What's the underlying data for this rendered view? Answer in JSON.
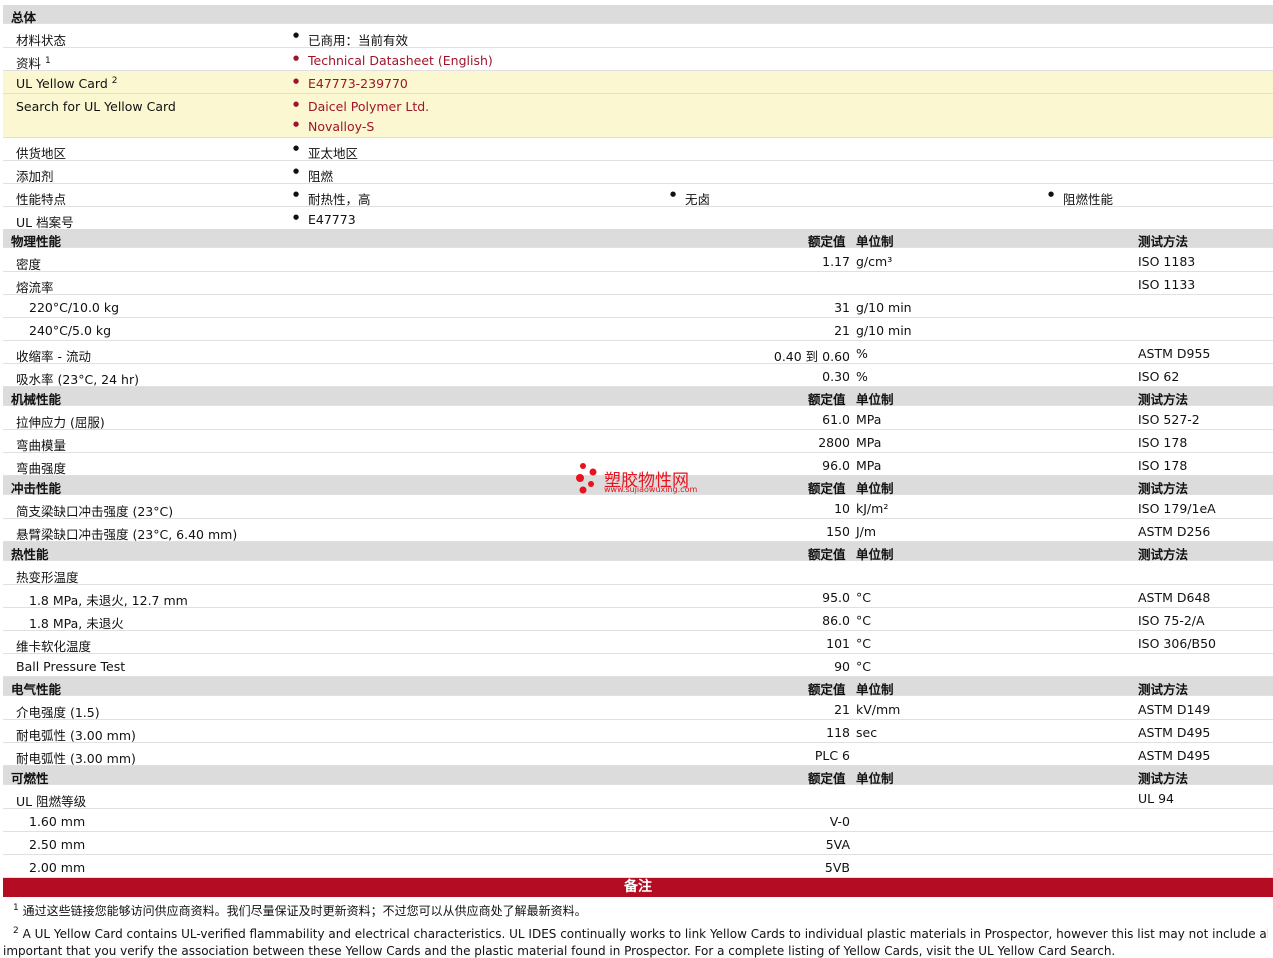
{
  "general": {
    "title": "总体",
    "rows": [
      {
        "label": "材料状态",
        "items": [
          "已商用：当前有效"
        ]
      },
      {
        "label": "资料",
        "sup": "1",
        "items": [
          "Technical Datasheet (English)"
        ]
      },
      {
        "label": "UL Yellow Card",
        "sup": "2",
        "items": [
          "E47773-239770"
        ]
      },
      {
        "label": "Search for UL Yellow Card",
        "items": [
          "Daicel Polymer Ltd.",
          "Novalloy-S"
        ]
      },
      {
        "label": "供货地区",
        "items": [
          "亚太地区"
        ]
      },
      {
        "label": "添加剂",
        "items": [
          "阻燃"
        ]
      },
      {
        "label": "性能特点",
        "items": [
          "耐热性，高",
          "无卤",
          "阻燃性能"
        ]
      },
      {
        "label": "UL 档案号",
        "items": [
          "E47773"
        ]
      }
    ]
  },
  "col_headers": {
    "value": "额定值",
    "unit": "单位制",
    "method": "测试方法"
  },
  "physical": {
    "title": "物理性能",
    "rows": [
      {
        "label": "密度",
        "value": "1.17",
        "unit": "g/cm³",
        "method": "ISO 1183"
      },
      {
        "label": "熔流率",
        "value": "",
        "unit": "",
        "method": "ISO 1133"
      },
      {
        "label": "220°C/10.0 kg",
        "value": "31",
        "unit": "g/10 min",
        "method": ""
      },
      {
        "label": "240°C/5.0 kg",
        "value": "21",
        "unit": "g/10 min",
        "method": ""
      },
      {
        "label": "收缩率  - 流动",
        "value": "0.40 到  0.60",
        "unit": "%",
        "method": "ASTM D955"
      },
      {
        "label": "吸水率  (23°C, 24 hr)",
        "value": "0.30",
        "unit": "%",
        "method": "ISO 62"
      }
    ]
  },
  "mechanical": {
    "title": "机械性能",
    "rows": [
      {
        "label": "拉伸应力  (屈服)",
        "value": "61.0",
        "unit": "MPa",
        "method": "ISO 527-2"
      },
      {
        "label": "弯曲模量",
        "value": "2800",
        "unit": "MPa",
        "method": "ISO 178"
      },
      {
        "label": "弯曲强度",
        "value": "96.0",
        "unit": "MPa",
        "method": "ISO 178"
      }
    ]
  },
  "impact": {
    "title": "冲击性能",
    "rows": [
      {
        "label": "简支梁缺口冲击强度  (23°C)",
        "value": "10",
        "unit": "kJ/m²",
        "method": "ISO 179/1eA"
      },
      {
        "label": "悬臂梁缺口冲击强度  (23°C, 6.40 mm)",
        "value": "150",
        "unit": "J/m",
        "method": "ASTM D256"
      }
    ]
  },
  "thermal": {
    "title": "热性能",
    "rows": [
      {
        "label": "热变形温度",
        "value": "",
        "unit": "",
        "method": ""
      },
      {
        "label": "1.8 MPa, 未退火, 12.7 mm",
        "value": "95.0",
        "unit": "°C",
        "method": "ASTM D648"
      },
      {
        "label": "1.8 MPa, 未退火",
        "value": "86.0",
        "unit": "°C",
        "method": "ISO 75-2/A"
      },
      {
        "label": "维卡软化温度",
        "value": "101",
        "unit": "°C",
        "method": "ISO 306/B50"
      },
      {
        "label": "Ball Pressure Test",
        "value": "90",
        "unit": "°C",
        "method": ""
      }
    ]
  },
  "electrical": {
    "title": "电气性能",
    "rows": [
      {
        "label": "介电强度  (1.5)",
        "value": "21",
        "unit": "kV/mm",
        "method": "ASTM D149"
      },
      {
        "label": "耐电弧性  (3.00 mm)",
        "value": "118",
        "unit": "sec",
        "method": "ASTM D495"
      },
      {
        "label": "耐电弧性  (3.00 mm)",
        "value": "PLC 6",
        "unit": "",
        "method": "ASTM D495"
      }
    ]
  },
  "flammability": {
    "title": "可燃性",
    "rows": [
      {
        "label": "UL 阻燃等级",
        "value": "",
        "unit": "",
        "method": "UL 94"
      },
      {
        "label": "1.60 mm",
        "value": "V-0",
        "unit": "",
        "method": ""
      },
      {
        "label": "2.50 mm",
        "value": "5VA",
        "unit": "",
        "method": ""
      },
      {
        "label": "2.00 mm",
        "value": "5VB",
        "unit": "",
        "method": ""
      }
    ]
  },
  "notes": {
    "title": "备注",
    "n1_sup": "1",
    "n1": "通过这些链接您能够访问供应商资料。我们尽量保证及时更新资料；不过您可以从供应商处了解最新资料。",
    "n2_sup": "2",
    "n2_line1": "A UL Yellow Card contains UL-verified flammability and electrical characteristics. UL IDES continually works to link Yellow Cards to individual plastic materials in Prospector, however this list may not include all of the a",
    "n2_line2": "important that you verify the association between these Yellow Cards and the plastic material found in Prospector. For a complete listing of Yellow Cards, visit the UL Yellow Card Search."
  },
  "watermark": {
    "title": "塑胶物性网",
    "url": "www.sujiaowuxing.com",
    "color": "#e8121d"
  }
}
